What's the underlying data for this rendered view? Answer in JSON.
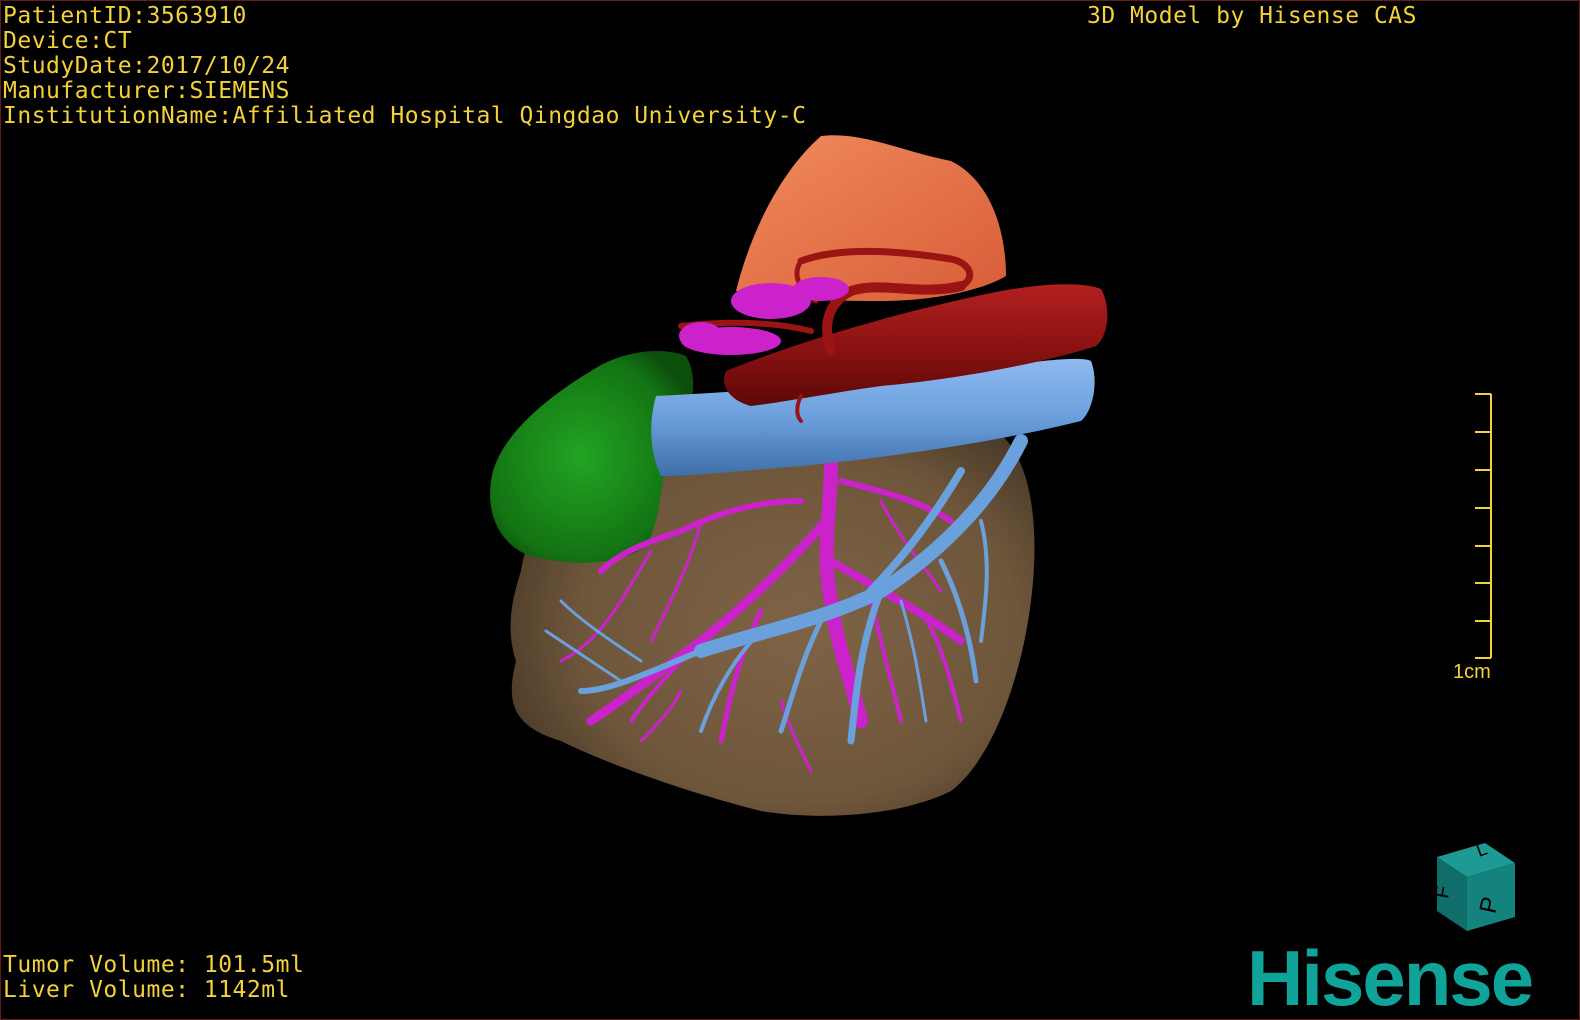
{
  "overlay": {
    "patient_id": "PatientID:3563910",
    "device": "Device:CT",
    "study_date": "StudyDate:2017/10/24",
    "manufacturer": "Manufacturer:SIEMENS",
    "institution": "InstitutionName:Affiliated Hospital Qingdao University-C",
    "model_credit": "3D Model by Hisense CAS",
    "tumor_volume": "Tumor Volume: 101.5ml",
    "liver_volume": "Liver Volume: 1142ml"
  },
  "scale_bar": {
    "label": "1cm"
  },
  "orientation_cube": {
    "face_front": "P",
    "face_side": "F",
    "face_top": "L"
  },
  "brand": {
    "logo_text": "Hisense"
  },
  "colors": {
    "overlay_text": "#f2d13a",
    "liver": "#7a5f40",
    "tumor": "#1a8a1a",
    "stomach": "#e8734a",
    "portal_vein": "#cc22cc",
    "hepatic_vein": "#6aa0dc",
    "aorta": "#8a1010",
    "brand": "#10a39a"
  }
}
